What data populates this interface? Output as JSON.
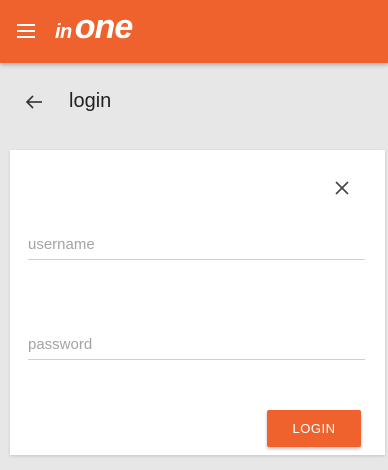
{
  "app_bar": {
    "brand_prefix": "in",
    "brand_name": "one",
    "menu_icon": "hamburger-menu-icon",
    "background_color": "#f0622d"
  },
  "toolbar": {
    "back_icon": "arrow-left-icon",
    "title": "login"
  },
  "login_form": {
    "close_icon": "close-icon",
    "username": {
      "value": "",
      "placeholder": "username"
    },
    "password": {
      "value": "",
      "placeholder": "password"
    },
    "submit_label": "LOGIN"
  }
}
